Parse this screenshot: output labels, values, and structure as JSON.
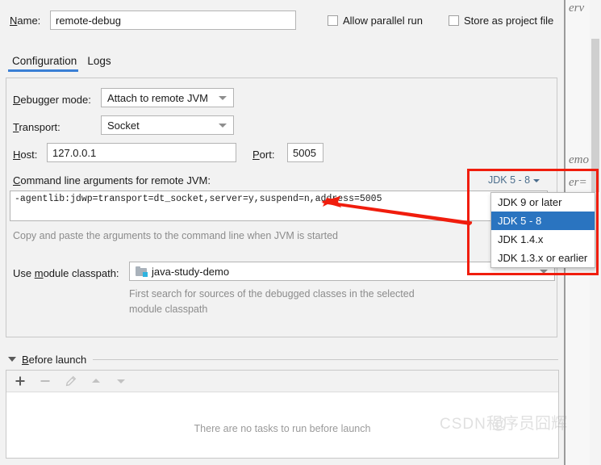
{
  "window": {
    "name_label": "Name:",
    "name_value": "remote-debug",
    "allow_parallel_run": "Allow parallel run",
    "store_as_project_file": "Store as project file",
    "gear_icon": "gear-icon"
  },
  "tabs": [
    {
      "label": "Configuration",
      "active": true
    },
    {
      "label": "Logs",
      "active": false
    }
  ],
  "configuration": {
    "debugger_mode_label": "Debugger mode:",
    "debugger_mode_value": "Attach to remote JVM",
    "transport_label": "Transport:",
    "transport_value": "Socket",
    "host_label": "Host:",
    "host_value": "127.0.0.1",
    "port_label": "Port:",
    "port_value": "5005",
    "args_label": "Command line arguments for remote JVM:",
    "args_value": "-agentlib:jdwp=transport=dt_socket,server=y,suspend=n,address=5005",
    "args_hint": "Copy and paste the arguments to the command line when JVM is started",
    "jdk_selector_value": "JDK 5 - 8",
    "module_classpath_label": "Use module classpath:",
    "module_classpath_value": "java-study-demo",
    "module_classpath_icon": "module-folder-icon",
    "module_hint_line1": "First search for sources of the debugged classes in the selected",
    "module_hint_line2": "module classpath"
  },
  "jdk_dropdown": {
    "options": [
      {
        "label": "JDK 9 or later",
        "selected": false
      },
      {
        "label": "JDK 5 - 8",
        "selected": true
      },
      {
        "label": "JDK 1.4.x",
        "selected": false
      },
      {
        "label": "JDK 1.3.x or earlier",
        "selected": false
      }
    ]
  },
  "before_launch": {
    "title": "Before launch",
    "empty_text": "There are no tasks to run before launch",
    "toolbar": [
      {
        "icon": "plus-icon",
        "enabled": true
      },
      {
        "icon": "minus-icon",
        "enabled": false
      },
      {
        "icon": "pencil-edit-icon",
        "enabled": false
      },
      {
        "icon": "arrow-up-icon",
        "enabled": false
      },
      {
        "icon": "arrow-down-icon",
        "enabled": false
      }
    ]
  },
  "background": {
    "text_top": "erv",
    "text_mid": "emo",
    "text_bottom": "er="
  },
  "annotations": {
    "highlight_box_color": "#f01d0d",
    "arrow_color": "#f01d0d"
  },
  "watermark": {
    "english": "CSDN @",
    "chinese": "程序员囧辉"
  },
  "colors": {
    "accent_blue": "#3a7fd5",
    "selection_blue": "#2a74c0",
    "panel_bg": "#f2f2f2",
    "link_blue": "#4a6d8c",
    "annotation_red": "#f01d0d"
  }
}
